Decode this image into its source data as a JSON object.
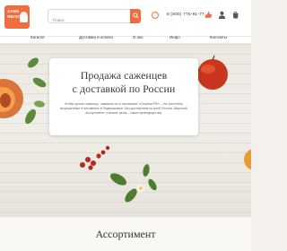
{
  "header": {
    "logo_text": "ЗАМЕ\nЯБЛОЧЬ",
    "search_placeholder": "Поиск",
    "phone": "8 (800) 775-91-77"
  },
  "nav": {
    "items": [
      "Каталог",
      "Доставка и оплата",
      "О нас",
      "Инфо",
      "Контакты"
    ]
  },
  "hero": {
    "title_line1": "Продажа саженцев",
    "title_line2": "с доставкой по России",
    "description": "Чтобы купить саженцы, закажите их в питомнике «Семена РФ» – это растения, выращенные в питомнике в Подмосковье. Мы доставляем по всей России. Широкий ассортимент и низкие цены – наши преимущества."
  },
  "sections": {
    "assortment_title": "Ассортимент"
  },
  "colors": {
    "accent": "#f26d3d",
    "card": "#ffffff",
    "background": "#f4f1ec"
  },
  "icons": [
    "search-icon",
    "whatsapp-icon",
    "favorites-icon",
    "user-icon",
    "cart-icon"
  ]
}
